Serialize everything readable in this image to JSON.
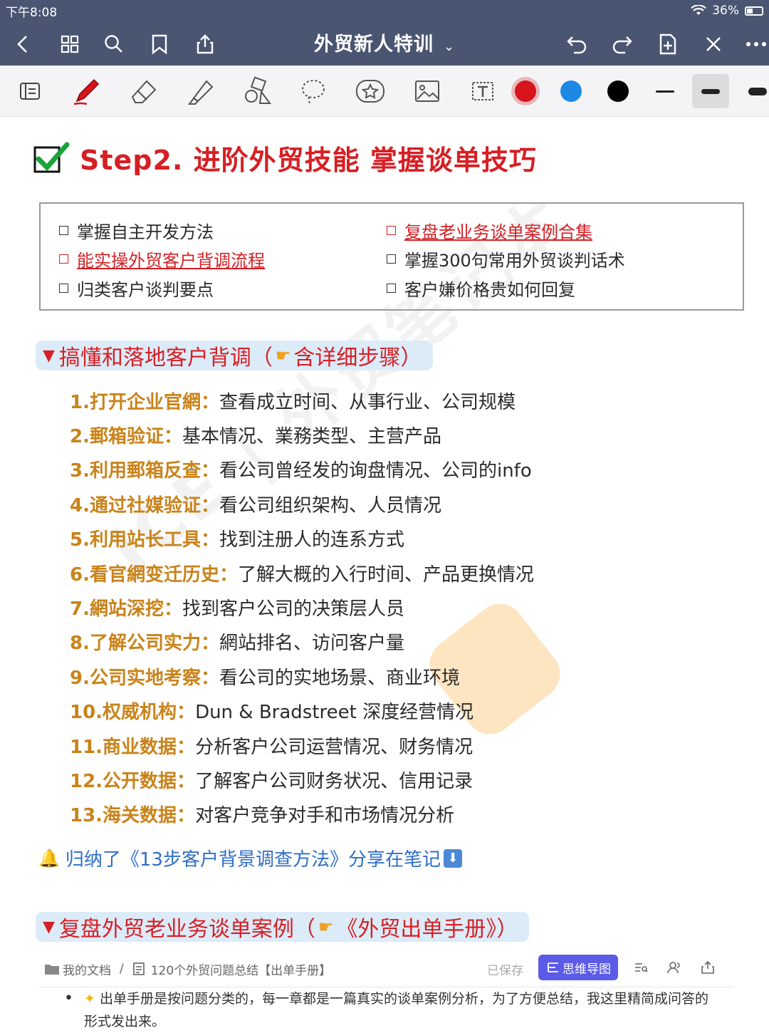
{
  "status": {
    "time": "下午8:08",
    "battery": "36%"
  },
  "nav": {
    "title": "外贸新人特训",
    "caret": "⌄"
  },
  "page": {
    "title": "Step2. 进阶外贸技能 掌握谈单技巧",
    "goals": [
      {
        "text": "掌握自主开发方法",
        "link": false
      },
      {
        "text": "复盘老业务谈单案例合集",
        "link": true
      },
      {
        "text": "能实操外贸客户背调流程",
        "link": true
      },
      {
        "text": "掌握300句常用外贸谈判话术",
        "link": false
      },
      {
        "text": "归类客户谈判要点",
        "link": false
      },
      {
        "text": "客户嫌价格贵如何回复",
        "link": false
      }
    ],
    "section1": {
      "title_a": "搞懂和落地客户背调（",
      "title_b": "含详细步骤）"
    },
    "steps": [
      {
        "label": "1.打开企业官網：",
        "desc": "查看成立时间、从事行业、公司规模"
      },
      {
        "label": "2.郵箱验证：",
        "desc": "基本情况、業務类型、主营产品"
      },
      {
        "label": "3.利用郵箱反查：",
        "desc": "看公司曾经发的询盘情况、公司的info"
      },
      {
        "label": "4.通过社媒验证：",
        "desc": "看公司组织架构、人员情况"
      },
      {
        "label": "5.利用站长工具：",
        "desc": "找到注册人的连系方式"
      },
      {
        "label": "6.看官網变迁历史：",
        "desc": "了解大概的入行时间、产品更换情况"
      },
      {
        "label": "7.網站深挖：",
        "desc": "找到客户公司的决策层人员"
      },
      {
        "label": "8.了解公司实力：",
        "desc": "網站排名、访问客户量"
      },
      {
        "label": "9.公司实地考察：",
        "desc": "看公司的实地场景、商业环境"
      },
      {
        "label": "10.权威机构：",
        "desc": "Dun & Bradstreet 深度经营情况"
      },
      {
        "label": "11.商业数据：",
        "desc": "分析客户公司运营情况、财务情况"
      },
      {
        "label": "12.公开数据：",
        "desc": "了解客户公司财务状况、信用记录"
      },
      {
        "label": "13.海关数据：",
        "desc": "对客户竞争对手和市场情况分析"
      }
    ],
    "summary": "归纳了《13步客户背景调查方法》分享在笔记",
    "section2": {
      "title_a": "复盘外贸老业务谈单案例（",
      "title_b": "《外贸出单手册》）"
    },
    "doc": {
      "folder": "我的文档",
      "sep": "/",
      "name": "120个外贸问题总结【出单手册】",
      "saved": "已保存",
      "mindmap": "思维导图"
    },
    "bullet": "出单手册是按问题分类的，每一章都是一篇真实的谈单案例分析，为了方便总结，我这里精简成问答的形式发出来。",
    "watermark": "ICE | 外贸笔记本"
  },
  "colors": {
    "bar": "#4a5572",
    "accent_red": "#d61f24",
    "label_orange": "#c9831a",
    "link_blue": "#2f6ec7",
    "pen_red": "#d8141c",
    "pen_blue": "#1e88e5",
    "pen_black": "#000000"
  }
}
